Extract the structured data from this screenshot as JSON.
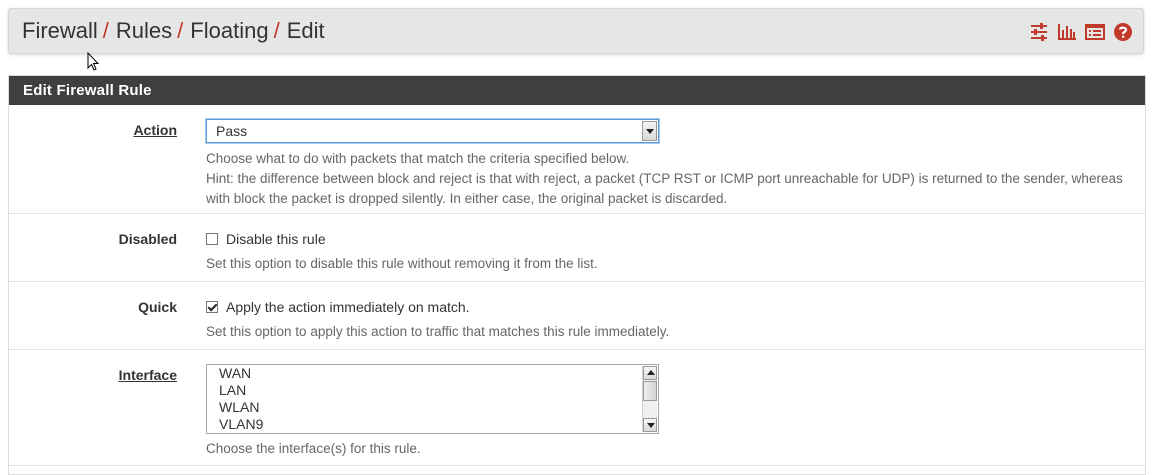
{
  "breadcrumb": {
    "items": [
      "Firewall",
      "Rules",
      "Floating",
      "Edit"
    ],
    "separator": "/"
  },
  "header_icons": [
    "sliders-icon",
    "bar-chart-icon",
    "log-list-icon",
    "help-icon"
  ],
  "panel": {
    "title": "Edit Firewall Rule"
  },
  "action": {
    "label": "Action",
    "selected": "Pass",
    "help_line1": "Choose what to do with packets that match the criteria specified below.",
    "help_line2": "Hint: the difference between block and reject is that with reject, a packet (TCP RST or ICMP port unreachable for UDP) is returned to the sender, whereas",
    "help_line3": "with block the packet is dropped silently. In either case, the original packet is discarded."
  },
  "disabled": {
    "label": "Disabled",
    "checkbox_label": "Disable this rule",
    "checked": false,
    "help": "Set this option to disable this rule without removing it from the list."
  },
  "quick": {
    "label": "Quick",
    "checkbox_label": "Apply the action immediately on match.",
    "checked": true,
    "help": "Set this option to apply this action to traffic that matches this rule immediately."
  },
  "interface": {
    "label": "Interface",
    "options": [
      "WAN",
      "LAN",
      "WLAN",
      "VLAN9"
    ],
    "help": "Choose the interface(s) for this rule."
  },
  "colors": {
    "accent": "#c0392b",
    "panel_heading": "#3f3f3f"
  }
}
